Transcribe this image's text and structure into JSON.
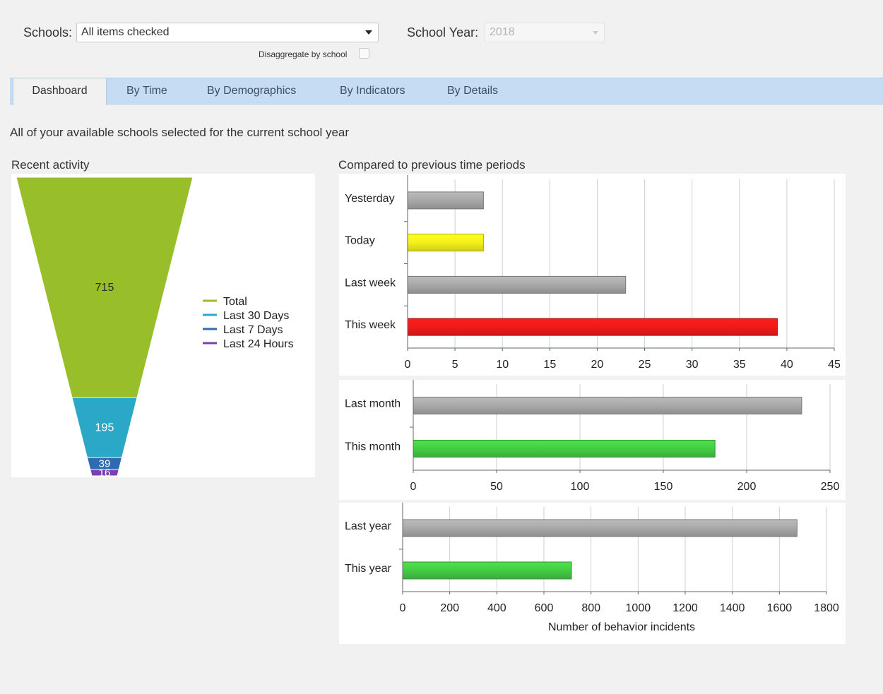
{
  "filters": {
    "schools_label": "Schools:",
    "schools_value": "All items checked",
    "disaggregate_label": "Disaggregate by school",
    "school_year_label": "School Year:",
    "school_year_value": "2018"
  },
  "tabs": [
    {
      "label": "Dashboard",
      "active": true
    },
    {
      "label": "By Time"
    },
    {
      "label": "By Demographics"
    },
    {
      "label": "By Indicators"
    },
    {
      "label": "By Details"
    }
  ],
  "subtitle": "All of your available schools selected for the current school year",
  "recent_activity": {
    "title": "Recent activity",
    "legend": [
      {
        "label": "Total",
        "color": "#98bf2a"
      },
      {
        "label": "Last 30 Days",
        "color": "#2ba7c8"
      },
      {
        "label": "Last 7 Days",
        "color": "#2d6bb5"
      },
      {
        "label": "Last 24 Hours",
        "color": "#7a3fb0"
      }
    ]
  },
  "compare": {
    "title": "Compared to previous time periods"
  },
  "chart_data": [
    {
      "type": "funnel",
      "categories": [
        "Total",
        "Last 30 Days",
        "Last 7 Days",
        "Last 24 Hours"
      ],
      "values": [
        715,
        195,
        39,
        16
      ],
      "colors": [
        "#98bf2a",
        "#2ba7c8",
        "#2d6bb5",
        "#7a3fb0"
      ],
      "legend_position": "right"
    },
    {
      "type": "bar",
      "orientation": "horizontal",
      "categories": [
        "Yesterday",
        "Today",
        "Last week",
        "This week"
      ],
      "values": [
        8,
        8,
        23,
        39
      ],
      "colors": [
        "#a8a8a8",
        "#f4f01c",
        "#a8a8a8",
        "#f01a1a"
      ],
      "xlim": [
        0,
        45
      ],
      "ticks": [
        0,
        5,
        10,
        15,
        20,
        25,
        30,
        35,
        40,
        45
      ],
      "grid": true
    },
    {
      "type": "bar",
      "orientation": "horizontal",
      "categories": [
        "Last month",
        "This month"
      ],
      "values": [
        233,
        181
      ],
      "colors": [
        "#a8a8a8",
        "#44cc44"
      ],
      "xlim": [
        0,
        250
      ],
      "ticks": [
        0,
        50,
        100,
        150,
        200,
        250
      ],
      "grid": true
    },
    {
      "type": "bar",
      "orientation": "horizontal",
      "categories": [
        "Last year",
        "This year"
      ],
      "values": [
        1675,
        717
      ],
      "colors": [
        "#a8a8a8",
        "#44cc44"
      ],
      "xlim": [
        0,
        1800
      ],
      "ticks": [
        0,
        200,
        400,
        600,
        800,
        1000,
        1200,
        1400,
        1600,
        1800
      ],
      "grid": true,
      "xlabel": "Number of behavior incidents"
    }
  ]
}
